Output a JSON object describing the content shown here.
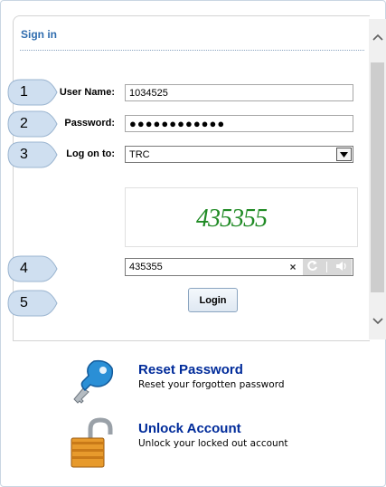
{
  "signin": {
    "title": "Sign in",
    "callouts": [
      "1",
      "2",
      "3",
      "4",
      "5"
    ],
    "fields": {
      "username_label": "User Name:",
      "username_value": "1034525",
      "password_label": "Password:",
      "password_value": "●●●●●●●●●●●●",
      "logon_label": "Log on to:",
      "logon_value": "TRC"
    },
    "captcha": {
      "image_text": "435355",
      "input_value": "435355",
      "clear_label": "×"
    },
    "login_label": "Login"
  },
  "links": [
    {
      "title": "Reset Password",
      "description": "Reset your forgotten password",
      "icon": "key-icon"
    },
    {
      "title": "Unlock Account",
      "description": "Unlock your locked out account",
      "icon": "padlock-icon"
    }
  ],
  "scrollbar": {
    "up_icon": "chevron-up-icon",
    "down_icon": "chevron-down-icon"
  },
  "colors": {
    "title": "#2f6cae",
    "link": "#002b9a",
    "callout_fill": "#cfdff0",
    "captcha": "#1f8a24"
  }
}
